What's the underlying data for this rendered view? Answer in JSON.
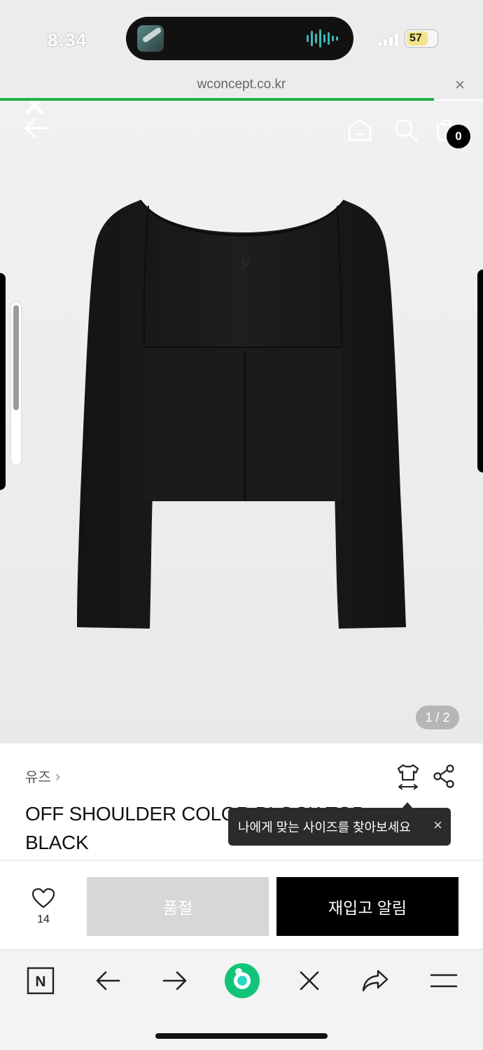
{
  "status_bar": {
    "time": "8:34",
    "battery": "57"
  },
  "browser": {
    "url": "wconcept.co.kr",
    "close_label": "×"
  },
  "product_image": {
    "page_indicator": "1 / 2",
    "bag_count": "0",
    "embroidery": "y"
  },
  "product": {
    "brand": "유즈",
    "brand_chevron": "›",
    "title_line1": "OFF SHOULDER COLOR BLOCK TOP",
    "title_line2": "BLACK"
  },
  "tooltip": {
    "text": "나에게 맞는 사이즈를 찾아보세요",
    "close": "×"
  },
  "purchase_bar": {
    "wish_count": "14",
    "soldout_label": "품절",
    "restock_label": "재입고 알림"
  },
  "browser_toolbar": {
    "naver_label": "N"
  },
  "colors": {
    "accent_green": "#1fb24d",
    "button_black": "#000000",
    "button_disabled": "#d7d7d7"
  }
}
